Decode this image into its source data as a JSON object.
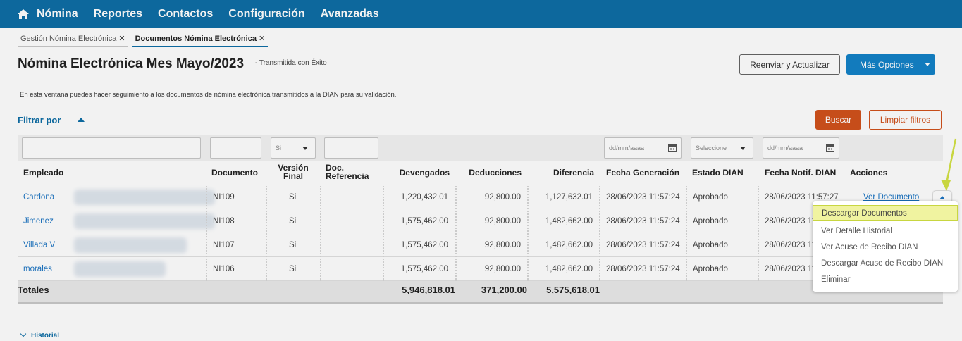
{
  "nav": {
    "items": [
      "Nómina",
      "Reportes",
      "Contactos",
      "Configuración",
      "Avanzadas"
    ],
    "home_icon": "home-icon",
    "bg_color": "#0e6ea6"
  },
  "tabs": [
    {
      "label": "Gestión Nómina Electrónica",
      "close": "✕"
    },
    {
      "label": "Documentos Nómina Electrónica",
      "close": "✕"
    }
  ],
  "page": {
    "title": "Nómina Electrónica Mes Mayo/2023",
    "status": "- Transmitida con Éxito",
    "description": "En esta ventana puedes hacer seguimiento a los documentos de nómina electrónica transmitidos a la DIAN para su validación."
  },
  "buttons": {
    "resend": "Reenviar y Actualizar",
    "more": "Más Opciones",
    "search": "Buscar",
    "clear": "Limpiar filtros",
    "search_color": "#d1521c",
    "more_color": "#1382c8"
  },
  "filters": {
    "label": "Filtrar por",
    "version_value": "Si",
    "date_placeholder": "dd/mm/aaaa",
    "estado_placeholder": "Seleccione"
  },
  "table": {
    "headers": {
      "empleado": "Empleado",
      "documento": "Documento",
      "version": "Versión Final",
      "referencia": "Doc. Referencia",
      "devengados": "Devengados",
      "deducciones": "Deducciones",
      "diferencia": "Diferencia",
      "fecha_gen": "Fecha Generación",
      "estado": "Estado DIAN",
      "fecha_notif": "Fecha Notif. DIAN",
      "acciones": "Acciones"
    },
    "rows": [
      {
        "empleado": "Cardona",
        "documento": "NI109",
        "version": "Si",
        "devengados": "1,220,432.01",
        "deducciones": "92,800.00",
        "diferencia": "1,127,632.01",
        "fecha_gen": "28/06/2023 11:57:24",
        "estado": "Aprobado",
        "fecha_notif": "28/06/2023 11:57:27"
      },
      {
        "empleado": "Jimenez",
        "documento": "NI108",
        "version": "Si",
        "devengados": "1,575,462.00",
        "deducciones": "92,800.00",
        "diferencia": "1,482,662.00",
        "fecha_gen": "28/06/2023 11:57:24",
        "estado": "Aprobado",
        "fecha_notif": "28/06/2023 11"
      },
      {
        "empleado": "Villada V",
        "documento": "NI107",
        "version": "Si",
        "devengados": "1,575,462.00",
        "deducciones": "92,800.00",
        "diferencia": "1,482,662.00",
        "fecha_gen": "28/06/2023 11:57:24",
        "estado": "Aprobado",
        "fecha_notif": "28/06/2023 11"
      },
      {
        "empleado": "morales",
        "documento": "NI106",
        "version": "Si",
        "devengados": "1,575,462.00",
        "deducciones": "92,800.00",
        "diferencia": "1,482,662.00",
        "fecha_gen": "28/06/2023 11:57:24",
        "estado": "Aprobado",
        "fecha_notif": "28/06/2023 11"
      }
    ],
    "totals": {
      "label": "Totales",
      "devengados": "5,946,818.01",
      "deducciones": "371,200.00",
      "diferencia": "5,575,618.01"
    },
    "row_action": "Ver Documento"
  },
  "menu": {
    "items": [
      "Descargar Documentos",
      "Ver Detalle Historial",
      "Ver Acuse de Recibo DIAN",
      "Descargar Acuse de Recibo DIAN",
      "Eliminar"
    ],
    "highlight_color": "#f0f3a0"
  },
  "historial": "Historial"
}
